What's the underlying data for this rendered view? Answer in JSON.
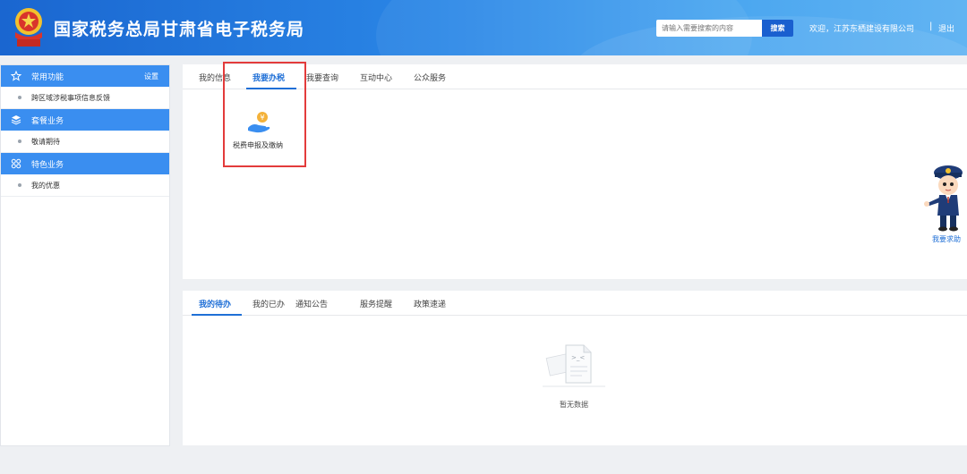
{
  "header": {
    "title": "国家税务总局甘肃省电子税务局",
    "search_placeholder": "请输入需要搜索的内容",
    "search_button": "搜索",
    "welcome_text": "欢迎，江苏东栖建设有限公司",
    "separator": "|",
    "logout": "退出",
    "emblem_icon": "tax-emblem-icon"
  },
  "sidebar": {
    "sections": [
      {
        "title": "常用功能",
        "icon": "star-icon",
        "action": "设置",
        "items": [
          "跨区域涉税事项信息反馈"
        ]
      },
      {
        "title": "套餐业务",
        "icon": "layers-icon",
        "items": [
          "敬请期待"
        ]
      },
      {
        "title": "特色业务",
        "icon": "grid-icon",
        "items": [
          "我的优惠"
        ]
      }
    ]
  },
  "top_panel": {
    "tabs": [
      "我的信息",
      "我要办税",
      "我要查询",
      "互动中心",
      "公众服务"
    ],
    "active_tab": "我要办税",
    "service": {
      "label": "税费申报及缴纳",
      "icon": "hand-coin-icon"
    }
  },
  "bottom_panel": {
    "tabs": [
      "我的待办",
      "我的已办",
      "通知公告",
      "服务提醒",
      "政策速递"
    ],
    "active_tab": "我的待办",
    "empty_text": "暂无数据",
    "empty_icon": "empty-document-icon"
  },
  "helper": {
    "label": "我要求助",
    "icon": "tax-officer-mascot-icon"
  },
  "colors": {
    "primary": "#1f6fd6",
    "header": "#2a86e6",
    "sidebar_section": "#3a8ef0",
    "highlight": "#e33b3b"
  }
}
